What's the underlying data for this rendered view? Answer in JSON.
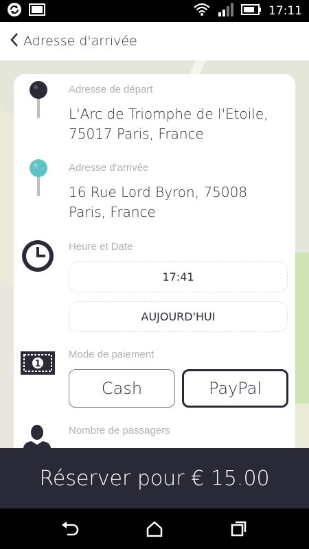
{
  "status_bar": {
    "time": "17:11",
    "icons": [
      "sync-icon",
      "image-icon",
      "wifi-icon",
      "signal-icon",
      "battery-icon"
    ]
  },
  "app_bar": {
    "title": "Adresse d'arrivée",
    "back_icon": "chevron-left-icon"
  },
  "form": {
    "departure": {
      "label": "Adresse de départ",
      "value": "L'Arc de Triomphe de l'Etoile, 75017 Paris, France",
      "icon": "dark-pin-icon"
    },
    "arrival": {
      "label": "Adresse d'arrivée",
      "value": "16 Rue Lord Byron, 75008 Paris, France",
      "icon": "teal-pin-icon"
    },
    "datetime": {
      "label": "Heure et Date",
      "time": "17:41",
      "date": "AUJOURD'HUI",
      "icon": "clock-icon"
    },
    "payment": {
      "label": "Mode de paiement",
      "options": [
        "Cash",
        "PayPal"
      ],
      "selected": "PayPal",
      "icon": "banknote-icon"
    },
    "passengers": {
      "label": "Nombre de passagers",
      "icon": "person-icon"
    }
  },
  "book_button": {
    "label": "Réserver pour € 15.00"
  },
  "nav": {
    "icons": [
      "back-nav-icon",
      "home-nav-icon",
      "recents-nav-icon"
    ]
  },
  "colors": {
    "dark": "#292937",
    "teal": "#5ec4c4",
    "label_gray": "#b0b0b6"
  }
}
